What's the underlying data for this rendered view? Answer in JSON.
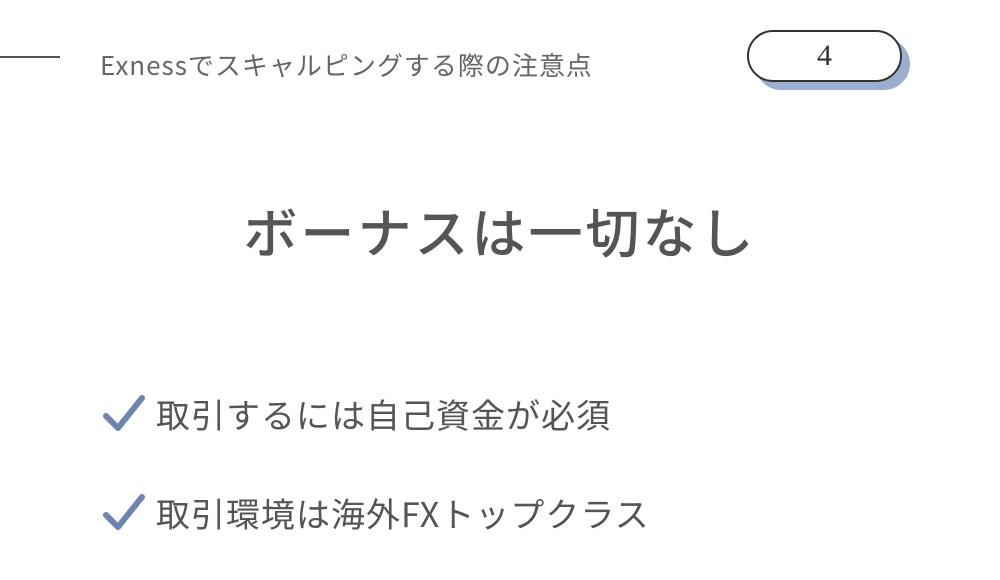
{
  "header": {
    "title": "Exnessでスキャルピングする際の注意点",
    "badge_number": "4"
  },
  "main": {
    "title": "ボーナスは一切なし"
  },
  "points": [
    {
      "text": "取引するには自己資金が必須"
    },
    {
      "text": "取引環境は海外FXトップクラス"
    }
  ],
  "colors": {
    "accent": "#9aaed0",
    "check": "#6e84b0",
    "text": "#555555"
  }
}
